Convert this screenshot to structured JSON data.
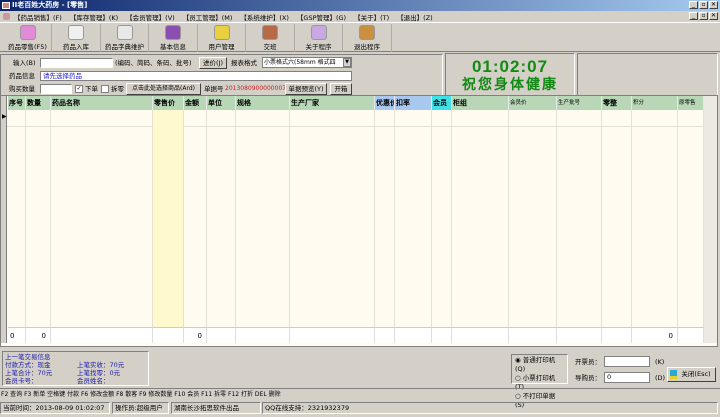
{
  "window": {
    "title": "II老百姓大药房 - [零售]",
    "min": "_",
    "restore": "▫",
    "close": "✕"
  },
  "menu": [
    "【药品销售】(F)",
    "【库存管理】(K)",
    "【会员管理】(V)",
    "【员工管理】(M)",
    "【系统维护】(X)",
    "【GSP管理】(G)",
    "【关于】(T)",
    "【退出】(Z)"
  ],
  "toolbar": [
    {
      "label": "药品零售(F5)",
      "color": "#e08ad8"
    },
    {
      "label": "药品入库",
      "color": "#f0f0f0"
    },
    {
      "label": "药品字典维护",
      "color": "#e8e8e8"
    },
    {
      "label": "基本信息",
      "color": "#8a4fb0"
    },
    {
      "label": "用户管理",
      "color": "#e8d040"
    },
    {
      "label": "交班",
      "color": "#b86a48"
    },
    {
      "label": "关于程序",
      "color": "#c8a8e0"
    },
    {
      "label": "退出程序",
      "color": "#c89040"
    }
  ],
  "form": {
    "input_label": "输入(B)",
    "input_value": "",
    "input_hint": "(编码、简码、条码、批号)",
    "price_btn": "进价(J)",
    "report_label": "报表格式",
    "report_value": "小票格式六(58mm 格式四",
    "drug_info_label": "药品信息",
    "drug_info_value": "请先选择药品",
    "qty_label": "购买数量",
    "qty_value": "",
    "order_check": "下单",
    "split_check": "拆零",
    "select_btn": "点击此处选择商品(Ard)",
    "bill_label": "单据号",
    "bill_no": "2013080900000007",
    "preview_btn": "单据预览(Y)",
    "open_btn": "开箱"
  },
  "clock": {
    "time": "01:02:07",
    "slogan": "祝您身体健康"
  },
  "grid": {
    "columns": [
      "序号",
      "数量",
      "药品名称",
      "零售价",
      "金额",
      "单位",
      "规格",
      "生产厂家",
      "优惠价",
      "扣率",
      "会员",
      "柜组",
      "会员价",
      "生产批号",
      "零整",
      "积分",
      "原零售"
    ],
    "totals": {
      "seq": "0",
      "qty": "0",
      "amount": "0",
      "points": "0"
    }
  },
  "last_trade": {
    "title": "上一笔交易信息",
    "pay_method": "付款方式：现金",
    "received": "上笔实收：70元",
    "total": "上笔合计：70元",
    "change": "上笔找零：0元",
    "card": "会员卡号：",
    "name": "会员姓名："
  },
  "print": {
    "options": [
      "普通打印机(Q)",
      "小票打印机(T)",
      "不打印单据(S)"
    ],
    "selected": 0
  },
  "issuer": {
    "label": "开票员：",
    "value": "",
    "key": "(K)"
  },
  "guide": {
    "label": "导购员：",
    "value": "0",
    "key": "(D)"
  },
  "close_btn": "关闭(Esc)",
  "shortcuts": "F2 查询 F3 新单   空格键 付款 F6 修改金额 F8 散客 F9 修改数量 F10 会员 F11 拆零 F12 打折 DEL 删除",
  "statusbar": {
    "time": "当前时间：2013-08-09 01:02:07",
    "operator": "操作员:超级用户",
    "vendor": "湖南长沙拓思软件出品",
    "support": "QQ在线支持：2321932379"
  }
}
